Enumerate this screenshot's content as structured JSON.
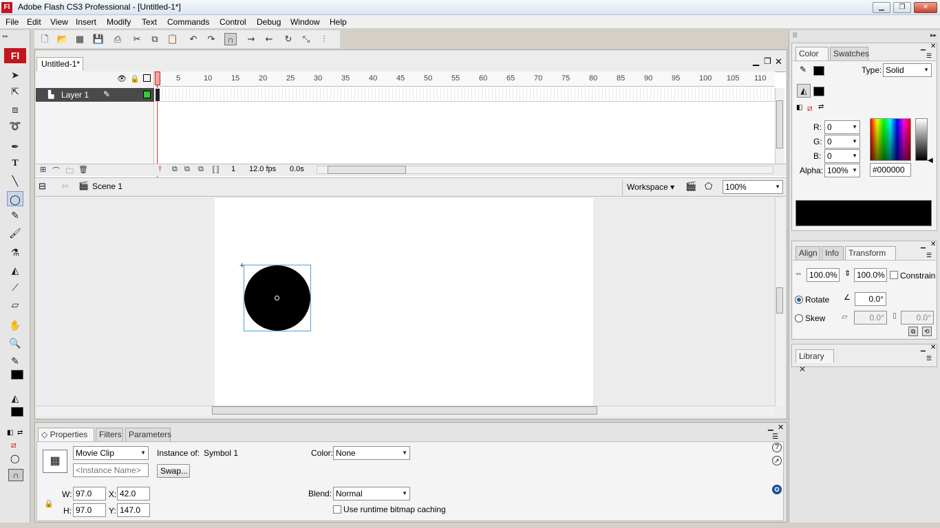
{
  "window": {
    "title": "Adobe Flash CS3 Professional - [Untitled-1*]",
    "logo": "Fl"
  },
  "menu": [
    "File",
    "Edit",
    "View",
    "Insert",
    "Modify",
    "Text",
    "Commands",
    "Control",
    "Debug",
    "Window",
    "Help"
  ],
  "app_logo": "Fl",
  "document": {
    "tab": "Untitled-1*"
  },
  "timeline": {
    "frame_numbers": [
      "1",
      "5",
      "10",
      "15",
      "20",
      "25",
      "30",
      "35",
      "40",
      "45",
      "50",
      "55",
      "60",
      "65",
      "70",
      "75",
      "80",
      "85",
      "90",
      "95",
      "100",
      "105",
      "110"
    ],
    "layer_name": "Layer 1",
    "current_frame": "1",
    "fps": "12.0 fps",
    "elapsed": "0.0s"
  },
  "editbar": {
    "scene": "Scene 1",
    "workspace": "Workspace",
    "zoom": "100%"
  },
  "color_panel": {
    "tabs": [
      "Color",
      "Swatches"
    ],
    "type_label": "Type:",
    "type_value": "Solid",
    "r_label": "R:",
    "r": "0",
    "g_label": "G:",
    "g": "0",
    "b_label": "B:",
    "b": "0",
    "alpha_label": "Alpha:",
    "alpha": "100%",
    "hex": "#000000",
    "swatch_color": "#000000"
  },
  "transform_panel": {
    "tabs": [
      "Align",
      "Info",
      "Transform"
    ],
    "width_pct": "100.0%",
    "height_pct": "100.0%",
    "constrain": "Constrain",
    "rotate_label": "Rotate",
    "rotate": "0.0°",
    "skew_label": "Skew",
    "skew_h": "0.0°",
    "skew_v": "0.0°"
  },
  "library_panel": {
    "tabs": [
      "Library"
    ]
  },
  "properties": {
    "tabs": [
      "Properties",
      "Filters",
      "Parameters"
    ],
    "symbol_type": "Movie Clip",
    "instance_of_label": "Instance of:",
    "instance_of": "Symbol 1",
    "instance_name_placeholder": "<Instance Name>",
    "swap": "Swap...",
    "color_label": "Color:",
    "color_value": "None",
    "blend_label": "Blend:",
    "blend_value": "Normal",
    "cache_label": "Use runtime bitmap caching",
    "w_label": "W:",
    "w": "97.0",
    "h_label": "H:",
    "h": "97.0",
    "x_label": "X:",
    "x": "42.0",
    "y_label": "Y:",
    "y": "147.0"
  }
}
